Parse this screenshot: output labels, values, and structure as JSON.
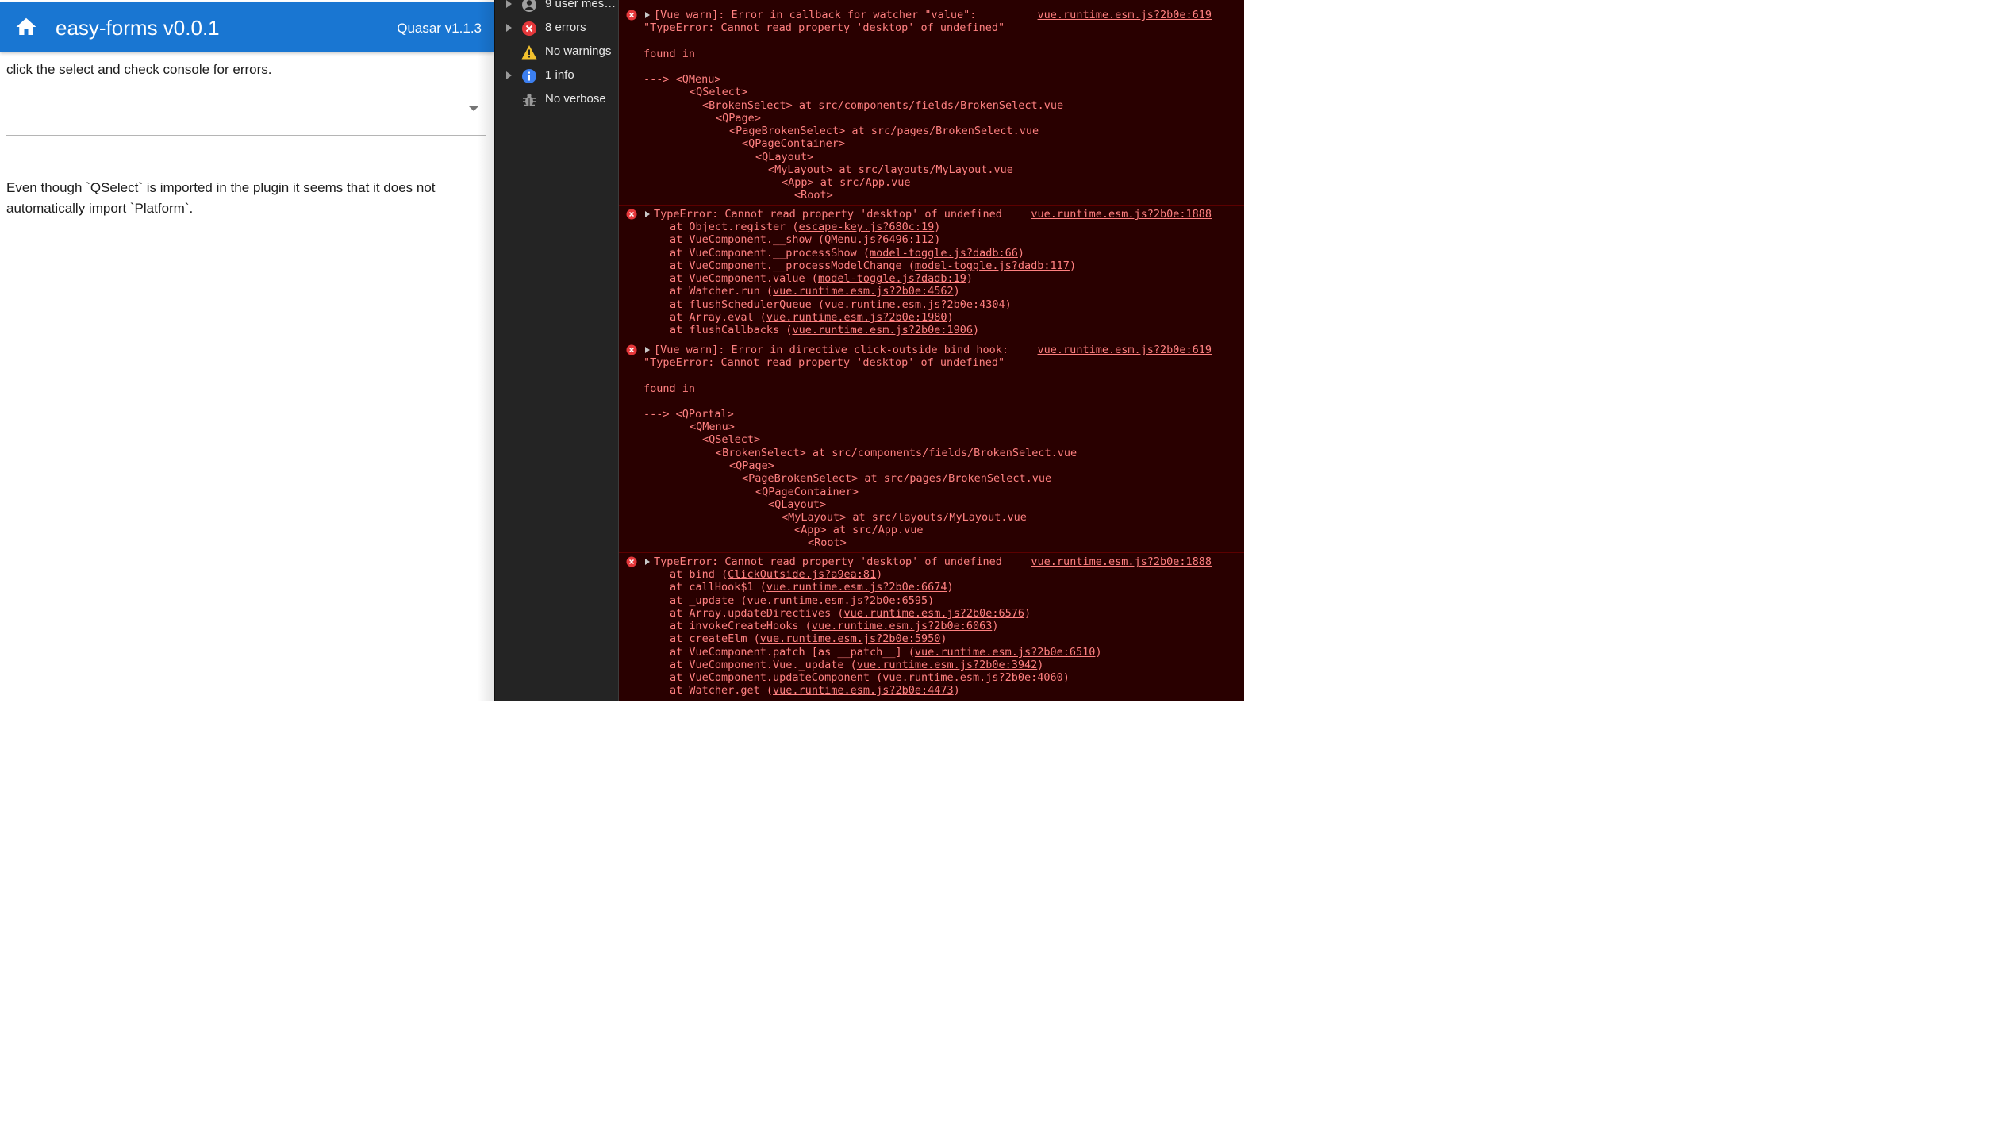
{
  "app": {
    "title": "easy-forms v0.0.1",
    "version": "Quasar v1.1.3",
    "intro": "click the select and check console for errors.",
    "note": "Even though `QSelect` is imported in the plugin it seems that it does not automatically import `Platform`.",
    "primary_color": "#1976d2",
    "home_icon": "home-icon",
    "select_icon": "arrow-drop-down-icon"
  },
  "sidebar": {
    "items": [
      {
        "label": "9 user mes…",
        "icon": "user-icon"
      },
      {
        "label": "8 errors",
        "icon": "error-icon"
      },
      {
        "label": "No warnings",
        "icon": "warning-icon"
      },
      {
        "label": "1 info",
        "icon": "info-icon"
      },
      {
        "label": "No verbose",
        "icon": "bug-icon"
      }
    ]
  },
  "console": {
    "background": "#290000",
    "text_color": "#ff8080",
    "m1": {
      "source": "vue.runtime.esm.js?2b0e:619",
      "l1": "[Vue warn]: Error in callback for watcher \"value\":",
      "l2": "\"TypeError: Cannot read property 'desktop' of undefined\"",
      "l3": "found in",
      "t1": "---> <QMenu>",
      "t2": "<QSelect>",
      "t3": "<BrokenSelect> at src/components/fields/BrokenSelect.vue",
      "t4": "<QPage>",
      "t5": "<PageBrokenSelect> at src/pages/BrokenSelect.vue",
      "t6": "<QPageContainer>",
      "t7": "<QLayout>",
      "t8": "<MyLayout> at src/layouts/MyLayout.vue",
      "t9": "<App> at src/App.vue",
      "t10": "<Root>"
    },
    "m2": {
      "source": "vue.runtime.esm.js?2b0e:1888",
      "l1": "TypeError: Cannot read property 'desktop' of undefined",
      "s1": {
        "fn": "at Object.register (",
        "link": "escape-key.js?680c:19"
      },
      "s2": {
        "fn": "at VueComponent.__show (",
        "link": "QMenu.js?6496:112"
      },
      "s3": {
        "fn": "at VueComponent.__processShow (",
        "link": "model-toggle.js?dadb:66"
      },
      "s4": {
        "fn": "at VueComponent.__processModelChange (",
        "link": "model-toggle.js?dadb:117"
      },
      "s5": {
        "fn": "at VueComponent.value (",
        "link": "model-toggle.js?dadb:19"
      },
      "s6": {
        "fn": "at Watcher.run (",
        "link": "vue.runtime.esm.js?2b0e:4562"
      },
      "s7": {
        "fn": "at flushSchedulerQueue (",
        "link": "vue.runtime.esm.js?2b0e:4304"
      },
      "s8": {
        "fn": "at Array.eval (",
        "link": "vue.runtime.esm.js?2b0e:1980"
      },
      "s9": {
        "fn": "at flushCallbacks (",
        "link": "vue.runtime.esm.js?2b0e:1906"
      }
    },
    "m3": {
      "source": "vue.runtime.esm.js?2b0e:619",
      "l1": "[Vue warn]: Error in directive click-outside bind hook:",
      "l2": "\"TypeError: Cannot read property 'desktop' of undefined\"",
      "l3": "found in",
      "t1": "---> <QPortal>",
      "t2": "<QMenu>",
      "t3": "<QSelect>",
      "t4": "<BrokenSelect> at src/components/fields/BrokenSelect.vue",
      "t5": "<QPage>",
      "t6": "<PageBrokenSelect> at src/pages/BrokenSelect.vue",
      "t7": "<QPageContainer>",
      "t8": "<QLayout>",
      "t9": "<MyLayout> at src/layouts/MyLayout.vue",
      "t10": "<App> at src/App.vue",
      "t11": "<Root>"
    },
    "m4": {
      "source": "vue.runtime.esm.js?2b0e:1888",
      "l1": "TypeError: Cannot read property 'desktop' of undefined",
      "s1": {
        "fn": "at bind (",
        "link": "ClickOutside.js?a9ea:81"
      },
      "s2": {
        "fn": "at callHook$1 (",
        "link": "vue.runtime.esm.js?2b0e:6674"
      },
      "s3": {
        "fn": "at _update (",
        "link": "vue.runtime.esm.js?2b0e:6595"
      },
      "s4": {
        "fn": "at Array.updateDirectives (",
        "link": "vue.runtime.esm.js?2b0e:6576"
      },
      "s5": {
        "fn": "at invokeCreateHooks (",
        "link": "vue.runtime.esm.js?2b0e:6063"
      },
      "s6": {
        "fn": "at createElm (",
        "link": "vue.runtime.esm.js?2b0e:5950"
      },
      "s7": {
        "fn": "at VueComponent.patch [as __patch__] (",
        "link": "vue.runtime.esm.js?2b0e:6510"
      },
      "s8": {
        "fn": "at VueComponent.Vue._update (",
        "link": "vue.runtime.esm.js?2b0e:3942"
      },
      "s9": {
        "fn": "at VueComponent.updateComponent (",
        "link": "vue.runtime.esm.js?2b0e:4060"
      },
      "s10": {
        "fn": "at Watcher.get (",
        "link": "vue.runtime.esm.js?2b0e:4473"
      }
    }
  }
}
